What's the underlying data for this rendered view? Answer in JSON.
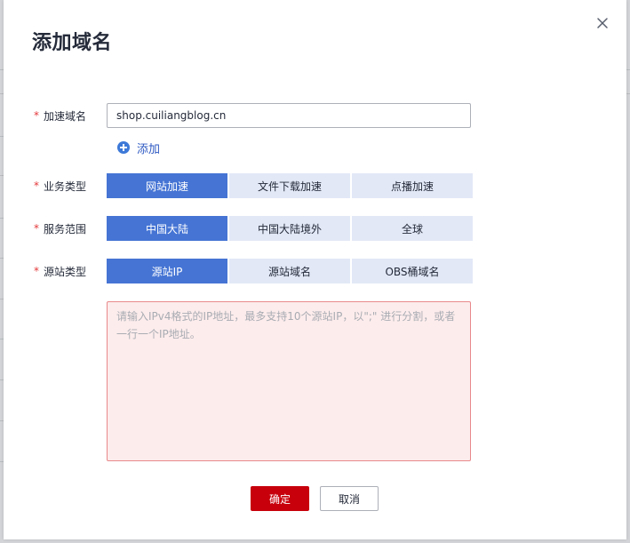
{
  "dialog": {
    "title": "添加域名",
    "close_icon": "close-icon"
  },
  "form": {
    "required_mark": "*",
    "domain": {
      "label": "加速域名",
      "value": "shop.cuiliangblog.cn",
      "add_label": "添加",
      "add_icon": "plus-circle-icon"
    },
    "business_type": {
      "label": "业务类型",
      "options": [
        "网站加速",
        "文件下载加速",
        "点播加速"
      ],
      "selected": 0
    },
    "service_scope": {
      "label": "服务范围",
      "options": [
        "中国大陆",
        "中国大陆境外",
        "全球"
      ],
      "selected": 0
    },
    "origin_type": {
      "label": "源站类型",
      "options": [
        "源站IP",
        "源站域名",
        "OBS桶域名"
      ],
      "selected": 0
    },
    "origin_ip": {
      "placeholder": "请输入IPv4格式的IP地址，最多支持10个源站IP，以\";\" 进行分割，或者一行一个IP地址。",
      "value": ""
    }
  },
  "actions": {
    "ok_label": "确定",
    "cancel_label": "取消"
  },
  "colors": {
    "primary": "#4574d4",
    "danger": "#c7000b",
    "error_border": "#e8898c",
    "error_bg": "#fdecec",
    "segment_bg": "#e2e8f6"
  }
}
